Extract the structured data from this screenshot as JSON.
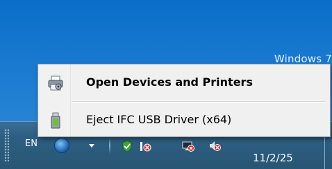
{
  "desktop": {
    "watermark": "Windows 7"
  },
  "context_menu": {
    "items": [
      {
        "label": "Open Devices and Printers",
        "icon": "printer-icon",
        "default": true
      },
      {
        "label": "Eject IFC USB Driver (x64)",
        "icon": "usb-drive-icon",
        "default": false
      }
    ]
  },
  "taskbar": {
    "language": "EN",
    "clock_date": "11/2/25",
    "tray_icons": [
      "action-center-shield-icon",
      "status-bars-icon",
      "network-disconnected-icon",
      "volume-muted-icon"
    ]
  }
}
